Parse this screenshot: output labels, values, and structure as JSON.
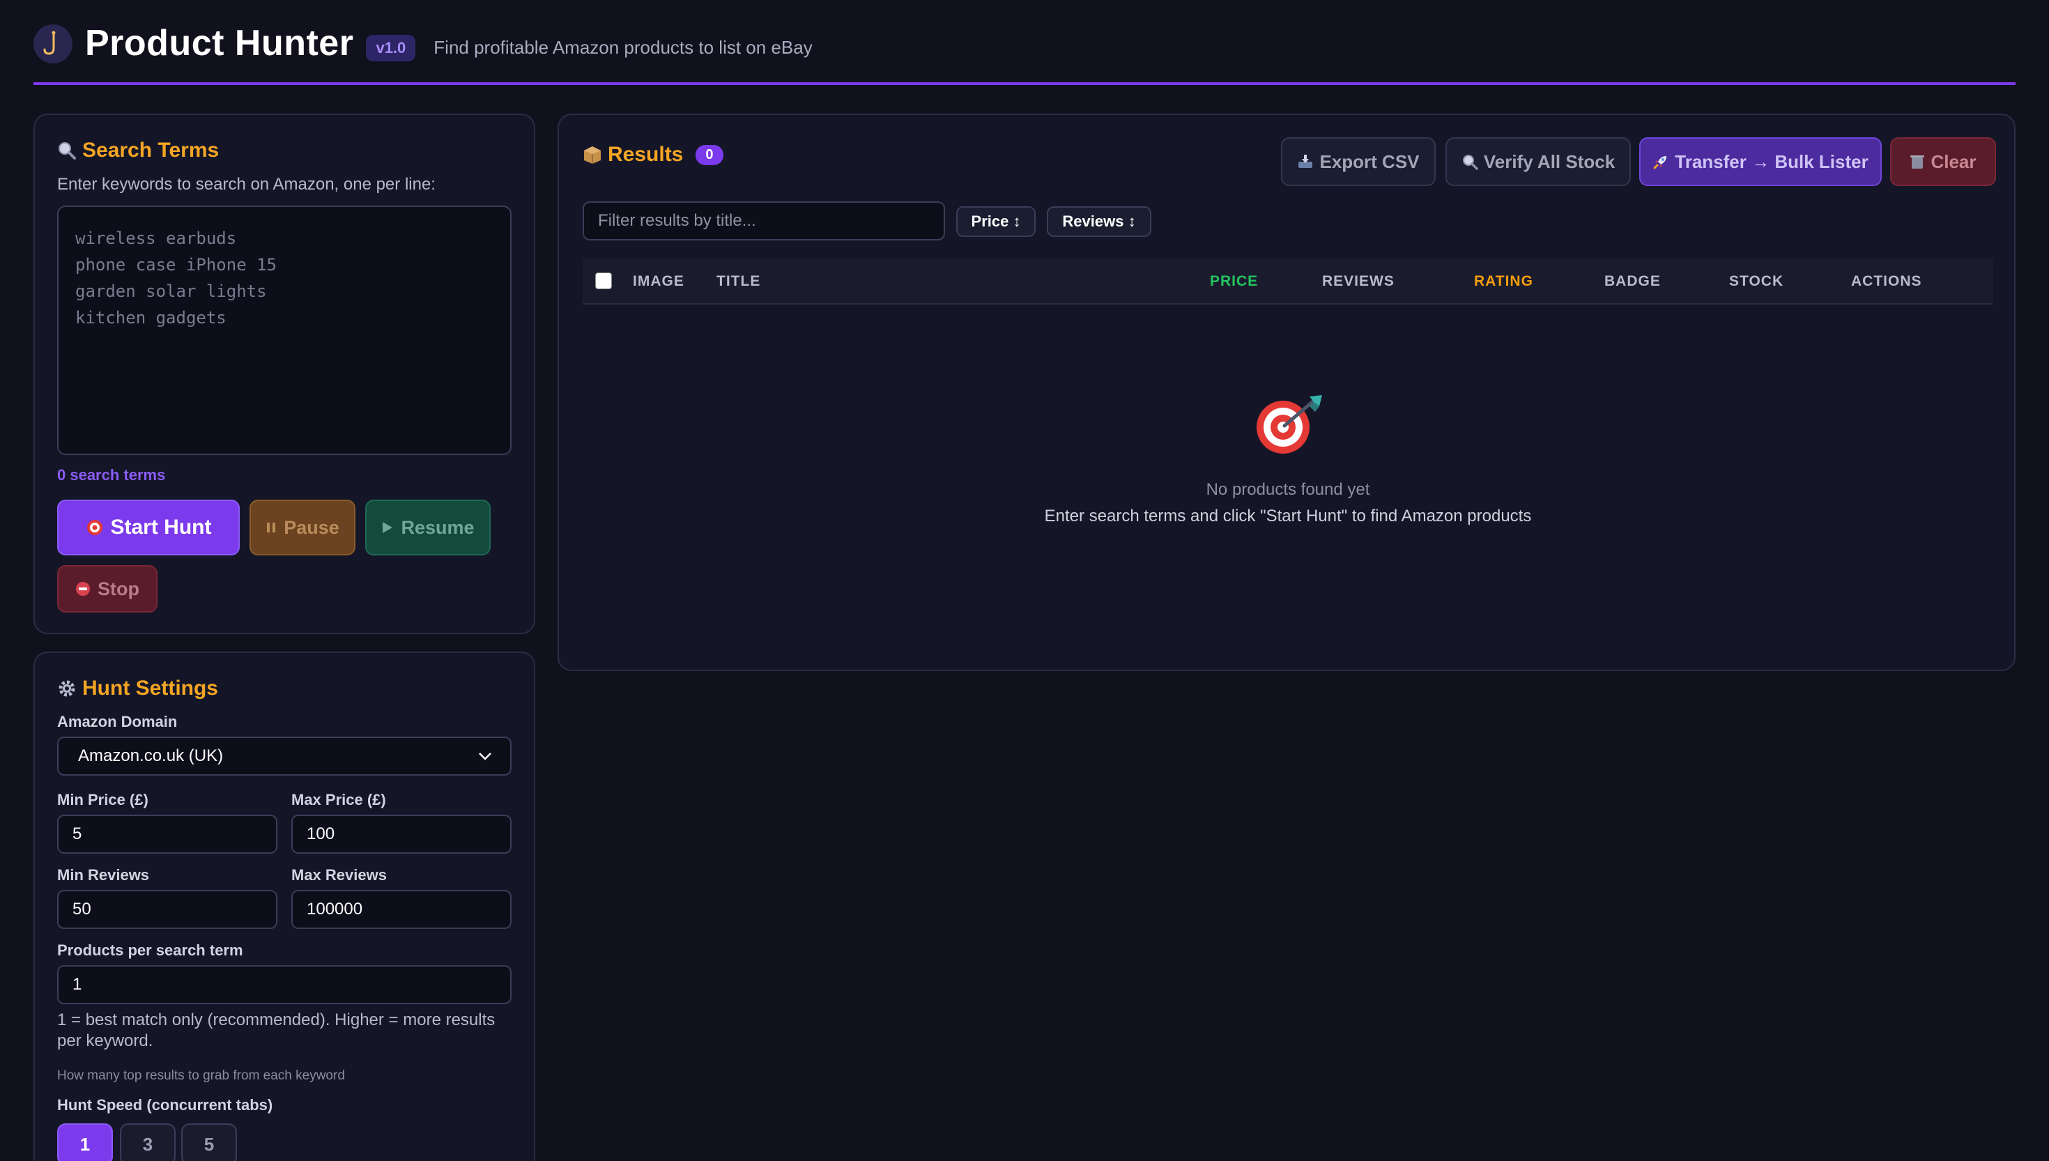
{
  "header": {
    "title": "Product Hunter",
    "version": "v1.0",
    "tagline": "Find profitable Amazon products to list on eBay"
  },
  "search": {
    "title": "Search Terms",
    "hint": "Enter keywords to search on Amazon, one per line:",
    "placeholder": "wireless earbuds\nphone case iPhone 15\ngarden solar lights\nkitchen gadgets",
    "count": "0 search terms",
    "start_label": "Start Hunt",
    "pause_label": "Pause",
    "resume_label": "Resume",
    "stop_label": "Stop"
  },
  "settings": {
    "title": "Hunt Settings",
    "domain_label": "Amazon Domain",
    "domain_value": "Amazon.co.uk (UK)",
    "min_price_label": "Min Price (£)",
    "min_price": "5",
    "max_price_label": "Max Price (£)",
    "max_price": "100",
    "min_reviews_label": "Min Reviews",
    "min_reviews": "50",
    "max_reviews_label": "Max Reviews",
    "max_reviews": "100000",
    "per_term_label": "Products per search term",
    "per_term": "1",
    "per_term_help": "1 = best match only (recommended). Higher = more results per keyword.",
    "per_term_small": "How many top results to grab from each keyword",
    "speed_label": "Hunt Speed (concurrent tabs)",
    "speed_options": [
      "1",
      "3",
      "5"
    ]
  },
  "results": {
    "title": "Results",
    "count": "0",
    "export_label": "Export CSV",
    "verify_label": "Verify All Stock",
    "transfer_label": "Transfer → Bulk Lister",
    "clear_label": "Clear",
    "filter_placeholder": "Filter results by title...",
    "sort_price": "Price ↕",
    "sort_reviews": "Reviews ↕",
    "columns": [
      "IMAGE",
      "TITLE",
      "PRICE",
      "REVIEWS",
      "RATING",
      "BADGE",
      "STOCK",
      "ACTIONS"
    ],
    "empty_title": "No products found yet",
    "empty_sub": "Enter search terms and click \"Start Hunt\" to find Amazon products"
  },
  "colors": {
    "accent": "#7c3aed",
    "heading": "#f5a524",
    "price_col": "#22c55e",
    "rating_col": "#f59e0b"
  }
}
